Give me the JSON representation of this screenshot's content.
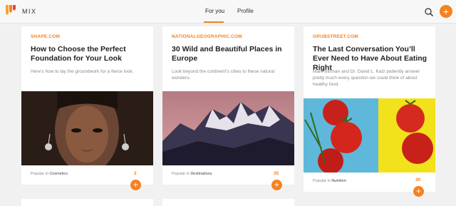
{
  "brand": {
    "name": "MIX",
    "accent": "#f58220"
  },
  "nav": {
    "tabs": [
      {
        "label": "For you",
        "active": true
      },
      {
        "label": "Profile",
        "active": false
      }
    ]
  },
  "header_icons": {
    "search": "search-icon",
    "add": "plus-icon"
  },
  "cards": [
    {
      "source": "SHAPE.COM",
      "title": "How to Choose the Perfect Foundation for Your Look",
      "description": "Here’s how to lay the groundwork for a fierce look.",
      "image": "portrait-photo",
      "popular_prefix": "Popular in",
      "category": "Cosmetics",
      "count": "2"
    },
    {
      "source": "NATIONALGEOGRAPHIC.COM",
      "title": "30 Wild and Beautiful Places in Europe",
      "description": "Look beyond the continent’s cities to these natural wonders.",
      "image": "mountain-photo",
      "popular_prefix": "Popular in",
      "category": "Destinations",
      "count": "35"
    },
    {
      "source": "GRUBSTREET.COM",
      "title": "The Last Conversation You’ll Ever Need to Have About Eating Right",
      "description": "Mark Bittman and Dr. David L. Katz patiently answer pretty much every question we could think of about healthy food.",
      "image": "tomato-photo",
      "popular_prefix": "Popular in",
      "category": "Nutrition",
      "count": "30"
    }
  ]
}
